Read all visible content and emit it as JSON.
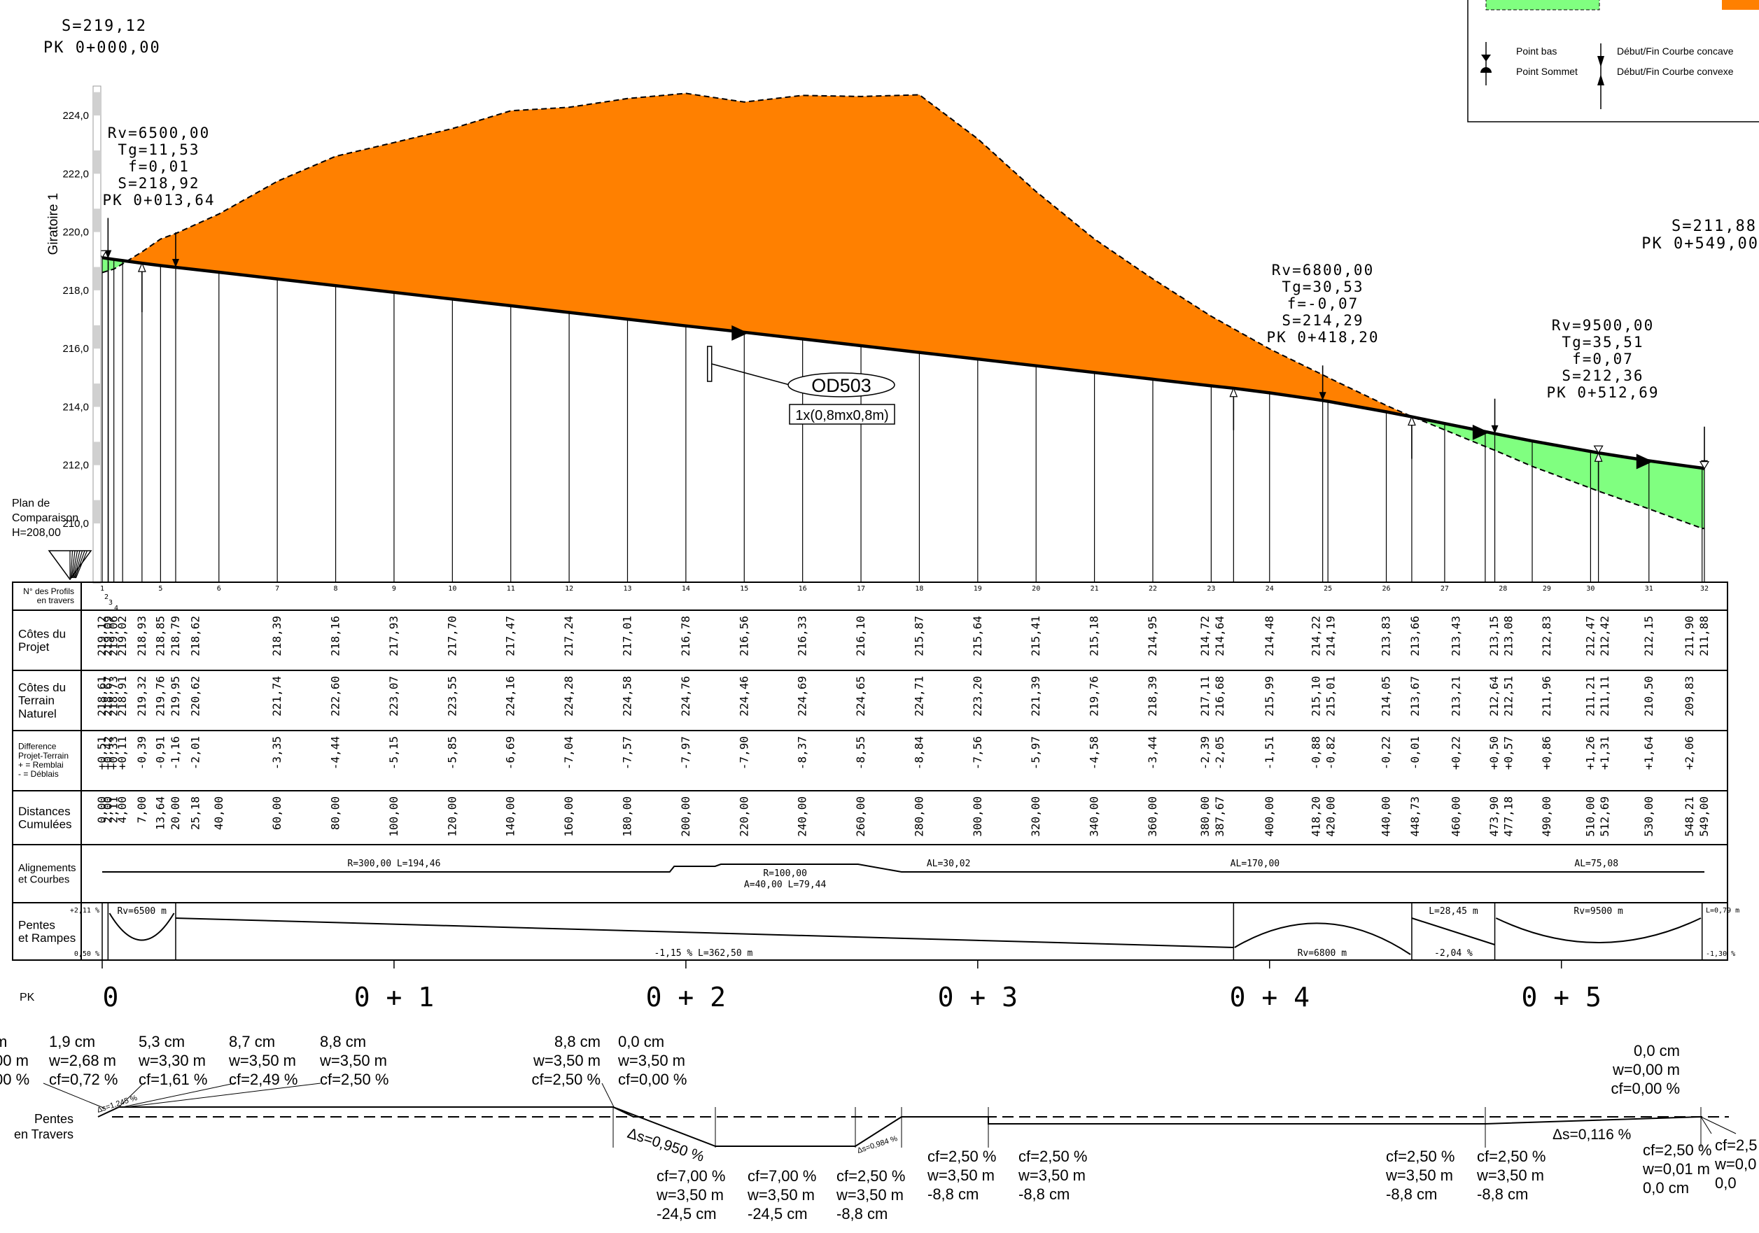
{
  "top_left": {
    "s": "S=219,12",
    "pk": "PK 0+000,00"
  },
  "top_right": {
    "s": "S=211,88",
    "pk": "PK 0+549,00"
  },
  "legend": {
    "point_bas": "Point bas",
    "point_sommet": "Point Sommet",
    "debut_concave": "Début/Fin Courbe concave",
    "debut_convexe": "Début/Fin Courbe convexe"
  },
  "axis": {
    "name": "Giratoire 1",
    "ticks": [
      "224,0",
      "222,0",
      "220,0",
      "218,0",
      "216,0",
      "214,0",
      "212,0",
      "210,0"
    ],
    "ticks_values": [
      224,
      222,
      220,
      218,
      216,
      214,
      212,
      210
    ]
  },
  "comparison_plane": {
    "line1": "Plan de",
    "line2": "Comparaison",
    "line3": "H=208,00"
  },
  "vertical_curves": [
    {
      "lines": [
        "Rv=6500,00",
        "Tg=11,53",
        "f=0,01",
        "S=218,92",
        "PK 0+013,64"
      ]
    },
    {
      "lines": [
        "Rv=6800,00",
        "Tg=30,53",
        "f=-0,07",
        "S=214,29",
        "PK 0+418,20"
      ]
    },
    {
      "lines": [
        "Rv=9500,00",
        "Tg=35,51",
        "f=0,07",
        "S=212,36",
        "PK 0+512,69"
      ]
    }
  ],
  "structure": {
    "name": "OD503",
    "size": "1x(0,8mx0,8m)"
  },
  "chart_data": {
    "type": "line",
    "x_unit": "distance cumulée (m)",
    "y_unit": "altitude (m)",
    "ylim": [
      208,
      225
    ],
    "xlim": [
      0,
      549
    ],
    "series": [
      {
        "name": "Côtes du Projet",
        "x": [
          0,
          2,
          4,
          7,
          13.64,
          20,
          25.18,
          40,
          60,
          80,
          100,
          120,
          140,
          160,
          180,
          200,
          220,
          240,
          260,
          280,
          300,
          320,
          340,
          360,
          380,
          387.67,
          400,
          418.2,
          420,
          440,
          448.73,
          460,
          473.9,
          477.18,
          490,
          510,
          512.69,
          530,
          548.21,
          549
        ],
        "values": [
          219.12,
          219.09,
          219.06,
          219.02,
          218.93,
          218.85,
          218.79,
          218.62,
          218.39,
          218.16,
          217.93,
          217.7,
          217.47,
          217.24,
          217.01,
          216.78,
          216.56,
          216.33,
          216.1,
          215.87,
          215.64,
          215.41,
          215.18,
          214.95,
          214.72,
          214.64,
          214.48,
          214.22,
          214.19,
          213.83,
          213.66,
          213.43,
          213.15,
          213.08,
          212.83,
          212.47,
          212.42,
          212.15,
          211.9,
          211.88
        ]
      },
      {
        "name": "Côtes du Terrain Naturel",
        "x": [
          0,
          2,
          4,
          7,
          13.64,
          20,
          25.18,
          40,
          60,
          80,
          100,
          120,
          140,
          160,
          180,
          200,
          220,
          240,
          260,
          280,
          300,
          320,
          340,
          360,
          380,
          387.67,
          400,
          418.2,
          420,
          440,
          448.73,
          460,
          473.9,
          477.18,
          490,
          510,
          512.69,
          530,
          548.21,
          549
        ],
        "values": [
          218.61,
          218.67,
          218.73,
          218.91,
          219.32,
          219.76,
          219.95,
          220.62,
          221.74,
          222.6,
          223.07,
          223.55,
          224.16,
          224.28,
          224.58,
          224.76,
          224.46,
          224.69,
          224.65,
          224.71,
          223.2,
          221.39,
          219.76,
          218.39,
          217.11,
          216.68,
          215.99,
          215.1,
          215.01,
          214.05,
          213.67,
          213.21,
          212.64,
          212.51,
          211.96,
          211.21,
          211.11,
          210.5,
          209.83,
          209.83
        ]
      }
    ]
  },
  "profiles": [
    "1",
    "2",
    "3",
    "4",
    "5",
    "6",
    "7",
    "8",
    "9",
    "10",
    "11",
    "12",
    "13",
    "14",
    "15",
    "16",
    "17",
    "18",
    "19",
    "20",
    "21",
    "22",
    "23",
    "24",
    "25",
    "26",
    "27",
    "28",
    "29",
    "30",
    "31",
    "32"
  ],
  "profiles_pos": [
    0,
    2,
    4,
    7,
    20,
    40,
    60,
    80,
    100,
    120,
    140,
    160,
    180,
    200,
    220,
    240,
    260,
    280,
    300,
    320,
    340,
    360,
    380,
    400,
    420,
    440,
    460,
    480,
    495,
    510,
    530,
    549
  ],
  "table": {
    "row_labels": {
      "profils": [
        "N° des Profils",
        "en travers"
      ],
      "projet": [
        "Côtes du",
        "Projet"
      ],
      "terrain": [
        "Côtes du",
        "Terrain",
        "Naturel"
      ],
      "difference": [
        "Difference",
        "Projet-Terrain",
        "+ = Remblai",
        "- = Déblais"
      ],
      "distances": [
        "Distances",
        "Cumulées"
      ],
      "alignements": [
        "Alignements",
        "et Courbes"
      ],
      "pentes": [
        "Pentes",
        "et Rampes"
      ]
    },
    "columns": [
      {
        "x": 0,
        "projet": "219,12",
        "terrain": "218,61",
        "diff": "+0,51",
        "dist": "0,00"
      },
      {
        "x": 2,
        "projet": "219,09",
        "terrain": "218,67",
        "diff": "+0,42",
        "dist": "2,00"
      },
      {
        "x": 4,
        "projet": "219,06",
        "terrain": "218,73",
        "diff": "+0,33",
        "dist": "2,11"
      },
      {
        "x": 7,
        "projet": "219,02",
        "terrain": "218,91",
        "diff": "+0,11",
        "dist": "4,00"
      },
      {
        "x": 13.64,
        "projet": "218,93",
        "terrain": "219,32",
        "diff": "-0,39",
        "dist": "7,00"
      },
      {
        "x": 20,
        "projet": "218,85",
        "terrain": "219,76",
        "diff": "-0,91",
        "dist": "13,64"
      },
      {
        "x": 25.18,
        "projet": "218,79",
        "terrain": "219,95",
        "diff": "-1,16",
        "dist": "20,00"
      },
      {
        "x": 32,
        "projet": "218,62",
        "terrain": "220,62",
        "diff": "-2,01",
        "dist": "25,18"
      },
      {
        "x": 40,
        "projet": "",
        "terrain": "",
        "diff": "",
        "dist": "40,00"
      },
      {
        "x": 60,
        "projet": "218,39",
        "terrain": "221,74",
        "diff": "-3,35",
        "dist": "60,00"
      },
      {
        "x": 80,
        "projet": "218,16",
        "terrain": "222,60",
        "diff": "-4,44",
        "dist": "80,00"
      },
      {
        "x": 100,
        "projet": "217,93",
        "terrain": "223,07",
        "diff": "-5,15",
        "dist": "100,00"
      },
      {
        "x": 120,
        "projet": "217,70",
        "terrain": "223,55",
        "diff": "-5,85",
        "dist": "120,00"
      },
      {
        "x": 140,
        "projet": "217,47",
        "terrain": "224,16",
        "diff": "-6,69",
        "dist": "140,00"
      },
      {
        "x": 160,
        "projet": "217,24",
        "terrain": "224,28",
        "diff": "-7,04",
        "dist": "160,00"
      },
      {
        "x": 180,
        "projet": "217,01",
        "terrain": "224,58",
        "diff": "-7,57",
        "dist": "180,00"
      },
      {
        "x": 200,
        "projet": "216,78",
        "terrain": "224,76",
        "diff": "-7,97",
        "dist": "200,00"
      },
      {
        "x": 220,
        "projet": "216,56",
        "terrain": "224,46",
        "diff": "-7,90",
        "dist": "220,00"
      },
      {
        "x": 240,
        "projet": "216,33",
        "terrain": "224,69",
        "diff": "-8,37",
        "dist": "240,00"
      },
      {
        "x": 260,
        "projet": "216,10",
        "terrain": "224,65",
        "diff": "-8,55",
        "dist": "260,00"
      },
      {
        "x": 280,
        "projet": "215,87",
        "terrain": "224,71",
        "diff": "-8,84",
        "dist": "280,00"
      },
      {
        "x": 300,
        "projet": "215,64",
        "terrain": "223,20",
        "diff": "-7,56",
        "dist": "300,00"
      },
      {
        "x": 320,
        "projet": "215,41",
        "terrain": "221,39",
        "diff": "-5,97",
        "dist": "320,00"
      },
      {
        "x": 340,
        "projet": "215,18",
        "terrain": "219,76",
        "diff": "-4,58",
        "dist": "340,00"
      },
      {
        "x": 360,
        "projet": "214,95",
        "terrain": "218,39",
        "diff": "-3,44",
        "dist": "360,00"
      },
      {
        "x": 378,
        "projet": "214,72",
        "terrain": "217,11",
        "diff": "-2,39",
        "dist": "380,00"
      },
      {
        "x": 383,
        "projet": "214,64",
        "terrain": "216,68",
        "diff": "-2,05",
        "dist": "387,67"
      },
      {
        "x": 400,
        "projet": "214,48",
        "terrain": "215,99",
        "diff": "-1,51",
        "dist": "400,00"
      },
      {
        "x": 416,
        "projet": "214,22",
        "terrain": "215,10",
        "diff": "-0,88",
        "dist": "418,20"
      },
      {
        "x": 421,
        "projet": "214,19",
        "terrain": "215,01",
        "diff": "-0,82",
        "dist": "420,00"
      },
      {
        "x": 440,
        "projet": "213,83",
        "terrain": "214,05",
        "diff": "-0,22",
        "dist": "440,00"
      },
      {
        "x": 450,
        "projet": "213,66",
        "terrain": "213,67",
        "diff": "-0,01",
        "dist": "448,73"
      },
      {
        "x": 464,
        "projet": "213,43",
        "terrain": "213,21",
        "diff": "+0,22",
        "dist": "460,00"
      },
      {
        "x": 477,
        "projet": "213,15",
        "terrain": "212,64",
        "diff": "+0,50",
        "dist": "473,90"
      },
      {
        "x": 482,
        "projet": "213,08",
        "terrain": "212,51",
        "diff": "+0,57",
        "dist": "477,18"
      },
      {
        "x": 495,
        "projet": "212,83",
        "terrain": "211,96",
        "diff": "+0,86",
        "dist": "490,00"
      },
      {
        "x": 510,
        "projet": "212,47",
        "terrain": "211,21",
        "diff": "+1,26",
        "dist": "510,00"
      },
      {
        "x": 515,
        "projet": "212,42",
        "terrain": "211,11",
        "diff": "+1,31",
        "dist": "512,69"
      },
      {
        "x": 530,
        "projet": "212,15",
        "terrain": "210,50",
        "diff": "+1,64",
        "dist": "530,00"
      },
      {
        "x": 544,
        "projet": "211,90",
        "terrain": "209,83",
        "diff": "+2,06",
        "dist": "548,21"
      },
      {
        "x": 549,
        "projet": "211,88",
        "terrain": "",
        "diff": "",
        "dist": "549,00"
      }
    ],
    "alignments": {
      "r300": "R=300,00     L=194,46",
      "r100_1": "R=100,00",
      "r100_2": "A=40,00     L=79,44",
      "al30": "AL=30,02",
      "al170": "AL=170,00",
      "al75": "AL=75,08"
    },
    "slopes": {
      "left_top": "+2,11 %",
      "left_bottom": "0,50 %",
      "rv6500": "Rv=6500 m",
      "main": "-1,15 %     L=362,50 m",
      "rv6800": "Rv=6800 m",
      "l2845": "L=28,45 m",
      "p204": "-2,04 %",
      "rv9500": "Rv=9500 m",
      "right_top": "L=0,79 m",
      "right_bottom": "-1,30 %"
    }
  },
  "pk": {
    "label": "PK",
    "items": [
      "0",
      "0 + 1",
      "0 + 2",
      "0 + 3",
      "0 + 4",
      "0 + 5"
    ],
    "positions": [
      0,
      100,
      200,
      300,
      400,
      500
    ]
  },
  "cross": {
    "label": [
      "Pentes",
      "en Travers"
    ],
    "ds_left": "Δs=1,245 %",
    "ds_950": "Δs=0,950 %",
    "ds_984": "Δs=0,984 %",
    "ds_116": "Δs=0,116 %",
    "annotations": [
      {
        "lines": [
          "m",
          "00 m",
          "00 %"
        ]
      },
      {
        "lines": [
          "1,9 cm",
          "w=2,68 m",
          "cf=0,72 %"
        ]
      },
      {
        "lines": [
          "5,3 cm",
          "w=3,30 m",
          "cf=1,61 %"
        ]
      },
      {
        "lines": [
          "8,7 cm",
          "w=3,50 m",
          "cf=2,49 %"
        ]
      },
      {
        "lines": [
          "8,8 cm",
          "w=3,50 m",
          "cf=2,50 %"
        ]
      },
      {
        "lines": [
          "8,8 cm",
          "w=3,50 m",
          "cf=2,50 %"
        ]
      },
      {
        "lines": [
          "0,0 cm",
          "w=3,50 m",
          "cf=0,00 %"
        ]
      },
      {
        "lines": [
          "cf=7,00 %",
          "w=3,50 m",
          "-24,5 cm"
        ]
      },
      {
        "lines": [
          "cf=7,00 %",
          "w=3,50 m",
          "-24,5 cm"
        ]
      },
      {
        "lines": [
          "cf=2,50 %",
          "w=3,50 m",
          "-8,8 cm"
        ]
      },
      {
        "lines": [
          "cf=2,50 %",
          "w=3,50 m",
          "-8,8 cm"
        ]
      },
      {
        "lines": [
          "cf=2,50 %",
          "w=3,50 m",
          "-8,8 cm"
        ]
      },
      {
        "lines": [
          "cf=2,50 %",
          "w=3,50 m",
          "-8,8 cm"
        ]
      },
      {
        "lines": [
          "cf=2,50 %",
          "w=3,50 m",
          "-8,8 cm"
        ]
      },
      {
        "lines": [
          "cf=2,50 %",
          "w=0,01 m",
          "0,0 cm"
        ]
      },
      {
        "lines": [
          "0,0 cm",
          "w=0,00 m",
          "cf=0,00 %"
        ]
      },
      {
        "lines": [
          "cf=2,5",
          "w=0,0",
          "0,0"
        ]
      }
    ]
  },
  "colors": {
    "cut": "#ff8000",
    "fill": "#80ff80",
    "line": "#000000",
    "axis_grey": "#d0d0d0"
  }
}
